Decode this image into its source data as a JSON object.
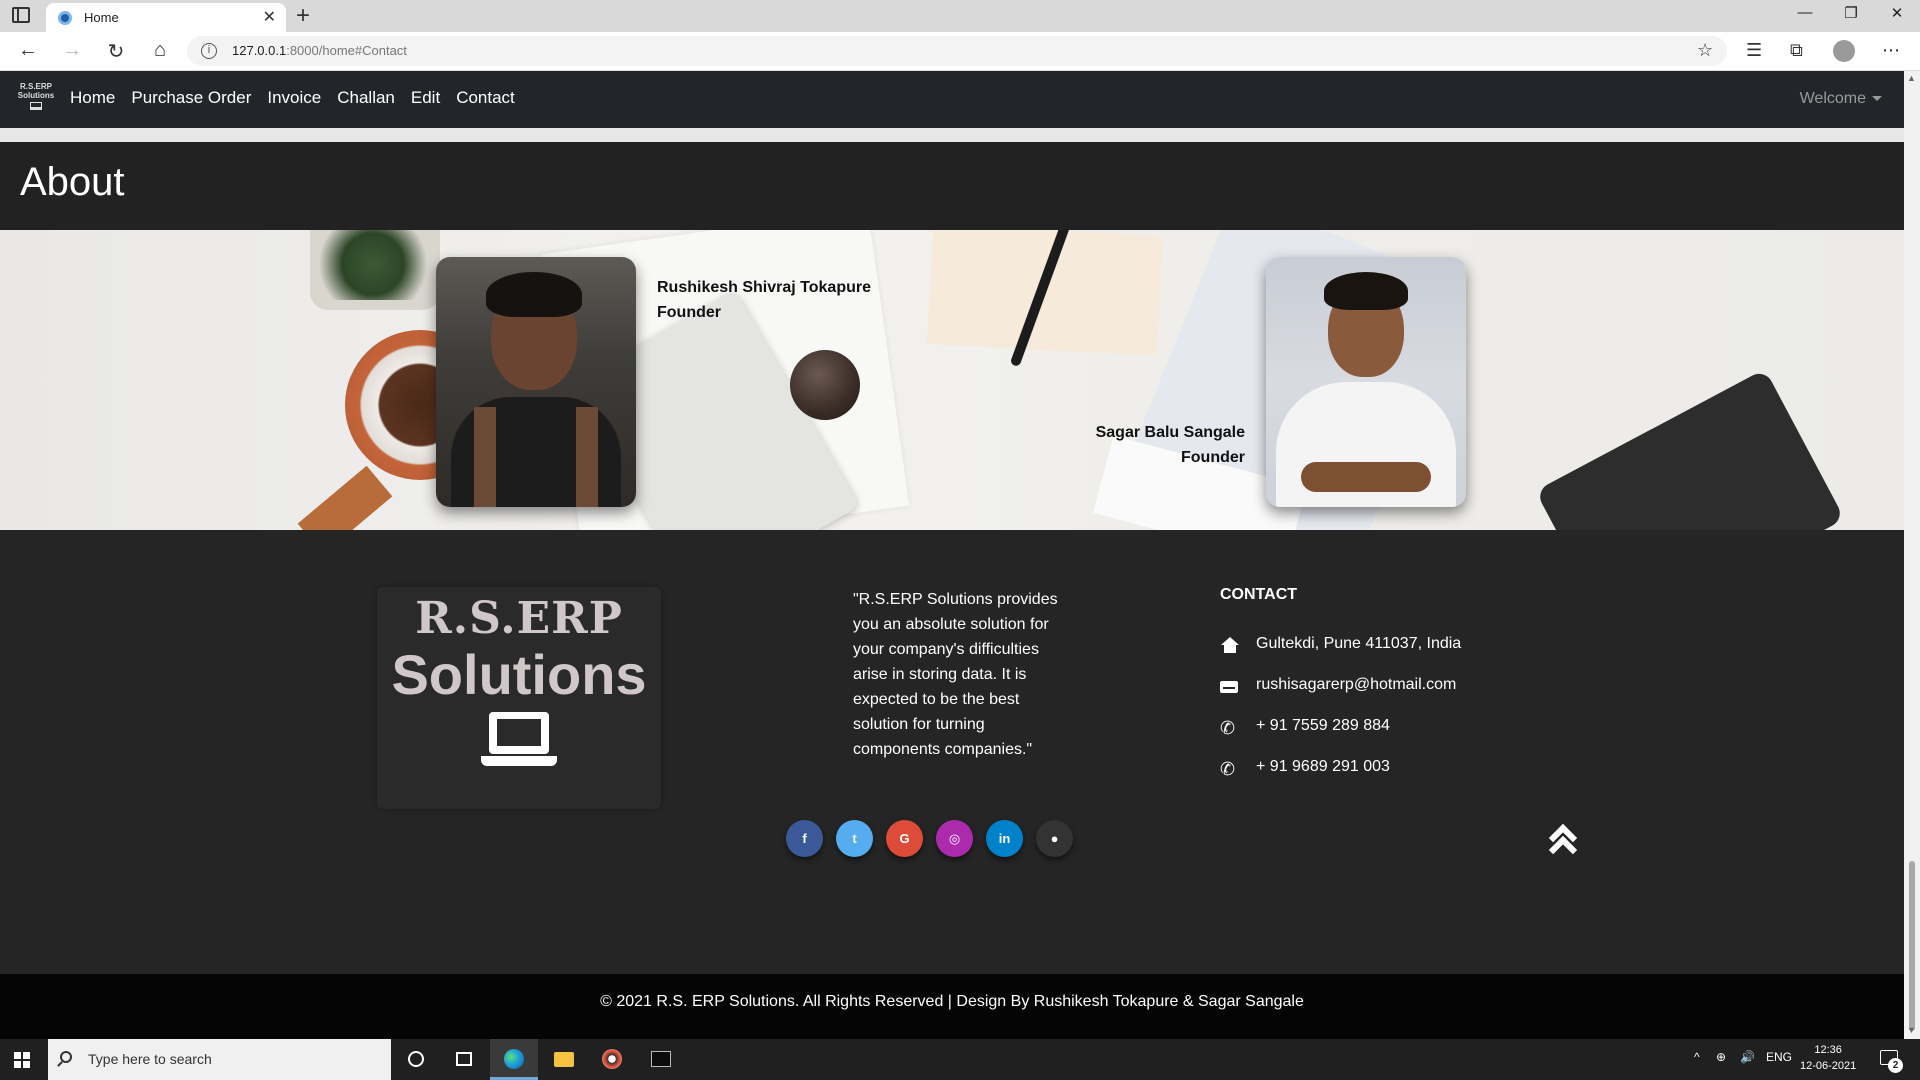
{
  "browser": {
    "tab_title": "Home",
    "url_host": "127.0.0.1",
    "url_rest": ":8000/home#Contact"
  },
  "site_nav": {
    "brand_line1": "R.S.ERP",
    "brand_line2": "Solutions",
    "links": [
      "Home",
      "Purchase Order",
      "Invoice",
      "Challan",
      "Edit",
      "Contact"
    ],
    "welcome": "Welcome"
  },
  "about": {
    "title": "About",
    "members": [
      {
        "name": "Rushikesh Shivraj Tokapure",
        "role": "Founder"
      },
      {
        "name": "Sagar Balu Sangale",
        "role": "Founder"
      }
    ]
  },
  "footer": {
    "logo_line1": "R.S.ERP",
    "logo_line2": "Solutions",
    "quote": "\"R.S.ERP Solutions provides you an absolute solution for your company's difficulties arise in storing data. It is expected to be the best solution for turning components companies.\"",
    "contact_title": "CONTACT",
    "contact": {
      "address": "Gultekdi, Pune 411037, India",
      "email": "rushisagarerp@hotmail.com",
      "phone1": "+ 91 7559 289 884",
      "phone2": "+ 91 9689 291 003"
    },
    "socials": [
      {
        "name": "facebook",
        "glyph": "f",
        "color": "#3b5998"
      },
      {
        "name": "twitter",
        "glyph": "t",
        "color": "#55acee"
      },
      {
        "name": "google",
        "glyph": "G",
        "color": "#dd4b39"
      },
      {
        "name": "instagram",
        "glyph": "◎",
        "color": "#ac2bac"
      },
      {
        "name": "linkedin",
        "glyph": "in",
        "color": "#0082ca"
      },
      {
        "name": "github",
        "glyph": "●",
        "color": "#333333"
      }
    ],
    "copyright": "© 2021 R.S. ERP Solutions. All Rights Reserved | Design By Rushikesh Tokapure & Sagar Sangale"
  },
  "taskbar": {
    "search_placeholder": "Type here to search",
    "lang": "ENG",
    "time": "12:36",
    "date": "12-06-2021",
    "notifications": "2"
  }
}
